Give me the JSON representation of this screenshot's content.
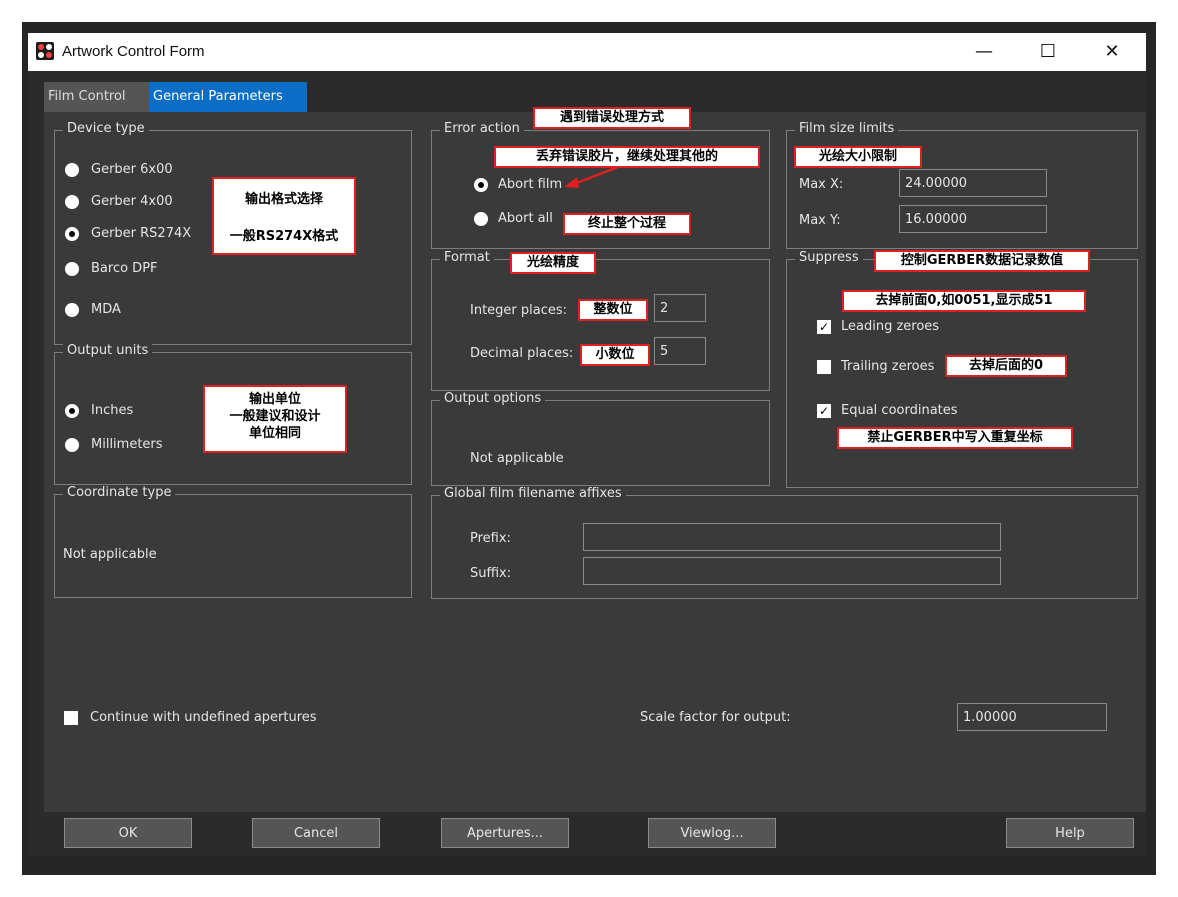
{
  "window": {
    "title": "Artwork Control Form",
    "controls": {
      "minimize": "—",
      "maximize": "☐",
      "close": "✕"
    }
  },
  "tabs": [
    {
      "label": "Film Control",
      "active": false
    },
    {
      "label": "General Parameters",
      "active": true
    }
  ],
  "device_type": {
    "label": "Device type",
    "options": [
      {
        "label": "Gerber 6x00",
        "selected": false
      },
      {
        "label": "Gerber 4x00",
        "selected": false
      },
      {
        "label": "Gerber RS274X",
        "selected": true
      },
      {
        "label": "Barco DPF",
        "selected": false
      },
      {
        "label": "MDA",
        "selected": false
      }
    ],
    "note_line1": "输出格式选择",
    "note_line2": "一般RS274X格式"
  },
  "output_units": {
    "label": "Output units",
    "options": [
      {
        "label": "Inches",
        "selected": true
      },
      {
        "label": "Millimeters",
        "selected": false
      }
    ],
    "note_line1": "输出单位",
    "note_line2": "一般建议和设计",
    "note_line3": "单位相同"
  },
  "coordinate_type": {
    "label": "Coordinate type",
    "value": "Not applicable"
  },
  "error_action": {
    "label": "Error action",
    "note": "遇到错误处理方式",
    "abort_film": "Abort film",
    "abort_film_note": "丢弃错误胶片，继续处理其他的",
    "abort_all": "Abort all",
    "abort_all_note": "终止整个过程",
    "selected": "Abort film"
  },
  "format": {
    "label": "Format",
    "note": "光绘精度",
    "integer_label": "Integer places:",
    "integer_note": "整数位",
    "integer_value": "2",
    "decimal_label": "Decimal places:",
    "decimal_note": "小数位",
    "decimal_value": "5"
  },
  "output_options": {
    "label": "Output options",
    "value": "Not applicable"
  },
  "film_size": {
    "label": "Film size limits",
    "note": "光绘大小限制",
    "max_x_label": "Max X:",
    "max_x": "24.00000",
    "max_y_label": "Max Y:",
    "max_y": "16.00000"
  },
  "suppress": {
    "label": "Suppress",
    "note": "控制GERBER数据记录数值",
    "leading_note": "去掉前面0,如0051,显示成51",
    "leading_label": "Leading zeroes",
    "leading_checked": true,
    "trailing_label": "Trailing zeroes",
    "trailing_note": "去掉后面的0",
    "trailing_checked": false,
    "equal_label": "Equal coordinates",
    "equal_checked": true,
    "equal_note": "禁止GERBER中写入重复坐标"
  },
  "affixes": {
    "label": "Global film filename affixes",
    "prefix_label": "Prefix:",
    "prefix_value": "",
    "suffix_label": "Suffix:",
    "suffix_value": ""
  },
  "continue_undefined": {
    "label": "Continue with undefined apertures",
    "checked": false
  },
  "scale": {
    "label": "Scale factor for output:",
    "value": "1.00000"
  },
  "buttons": {
    "ok": "OK",
    "cancel": "Cancel",
    "apertures": "Apertures...",
    "viewlog": "Viewlog...",
    "help": "Help"
  },
  "colors": {
    "accent_tab": "#0a6ec7",
    "note_border": "#e02020",
    "arrow": "#e02020"
  }
}
